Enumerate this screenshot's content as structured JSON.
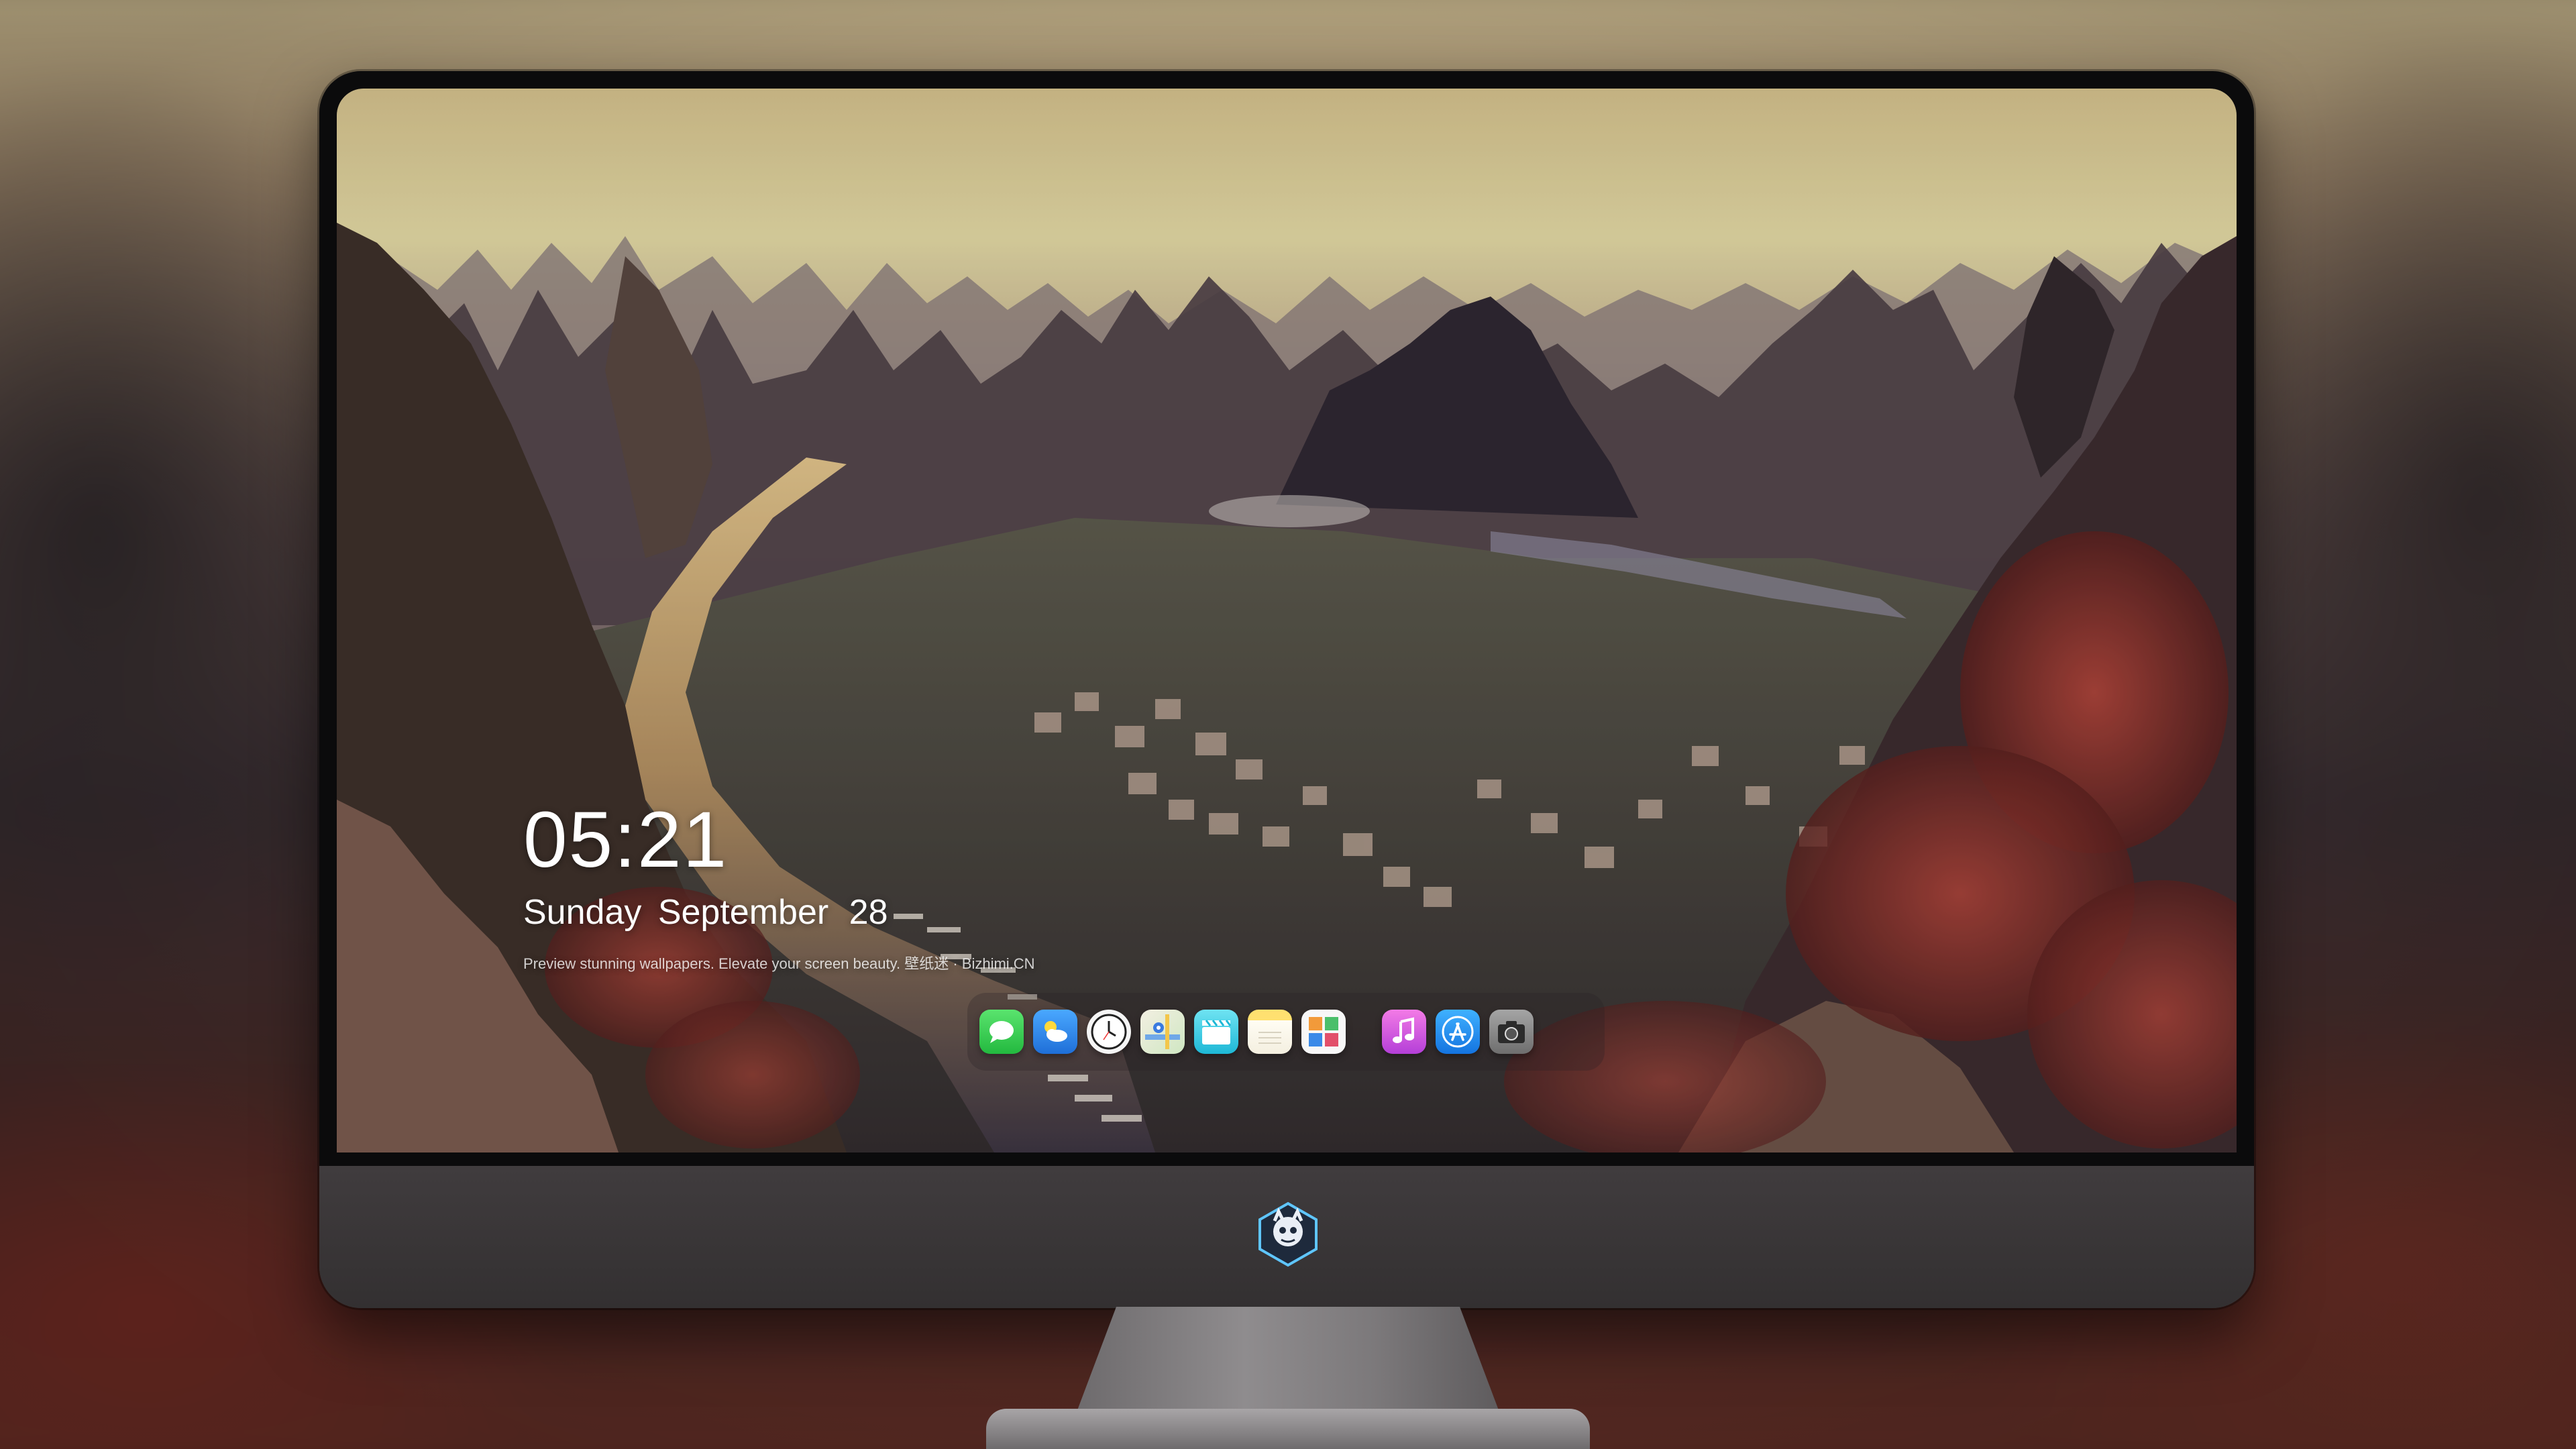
{
  "lockscreen": {
    "time": "05:21",
    "day": "Sunday",
    "month": "September",
    "date": "28",
    "tagline": "Preview stunning wallpapers. Elevate your screen beauty. 壁纸迷 · Bizhimi.CN"
  },
  "dock": {
    "apps": [
      {
        "name": "messages",
        "icon": "speech-bubble-icon",
        "color": "#2fd24f"
      },
      {
        "name": "weather",
        "icon": "cloud-sun-icon",
        "color": "#2f8cf0"
      },
      {
        "name": "clock",
        "icon": "clock-icon",
        "color": "#ffffff"
      },
      {
        "name": "maps",
        "icon": "map-icon",
        "color": "#e7e3d6"
      },
      {
        "name": "videos",
        "icon": "clapperboard-icon",
        "color": "#3fd0e6"
      },
      {
        "name": "notes",
        "icon": "notes-icon",
        "color": "#f6d34a"
      },
      {
        "name": "photos",
        "icon": "photos-icon",
        "color": "#f2f2f2"
      },
      {
        "name": "music",
        "icon": "music-note-icon",
        "color": "#e85fd8"
      },
      {
        "name": "app-store",
        "icon": "app-store-icon",
        "color": "#1c8ef0"
      },
      {
        "name": "camera",
        "icon": "camera-icon",
        "color": "#8c8c8c"
      }
    ]
  },
  "monitor": {
    "logo": "mascot-logo-icon"
  }
}
